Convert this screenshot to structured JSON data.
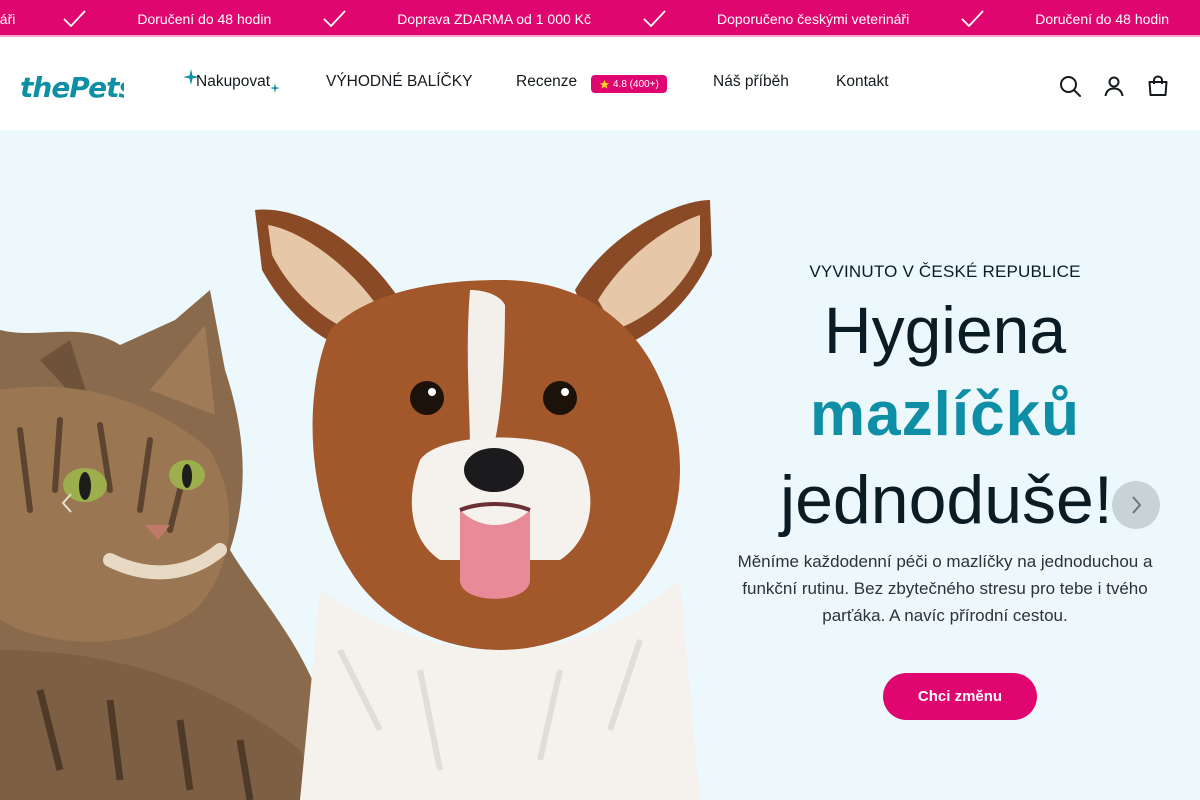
{
  "announcement": {
    "items": [
      "náři",
      "Doručení do 48 hodin",
      "Doprava ZDARMA od 1 000 Kč",
      "Doporučeno českými veterináři",
      "Doručení do 48 hodin"
    ]
  },
  "header": {
    "logo_text": "thePets",
    "nav": {
      "shop": "Nakupovat",
      "packs": "VÝHODNÉ BALÍČKY",
      "reviews": "Recenze",
      "rating": "4.8 (400+)",
      "story": "Náš příběh",
      "contact": "Kontakt"
    },
    "icons": [
      "search-icon",
      "account-icon",
      "cart-icon"
    ]
  },
  "hero": {
    "eyebrow": "VYVINUTO V ČESKÉ REPUBLICE",
    "headline_1": "Hygiena",
    "headline_2": "mazlíčků",
    "headline_3": "jednoduše!",
    "description": "Měníme každodenní péči o mazlíčky na jednoduchou a funkční rutinu. Bez zbytečného stresu pro tebe i tvého parťáka. A navíc přírodní cestou.",
    "cta": "Chci změnu"
  },
  "colors": {
    "brand_pink": "#e0066f",
    "brand_teal": "#0f8fa6",
    "hero_bg": "#ecf8fb",
    "text_dark": "#0c1c24"
  }
}
